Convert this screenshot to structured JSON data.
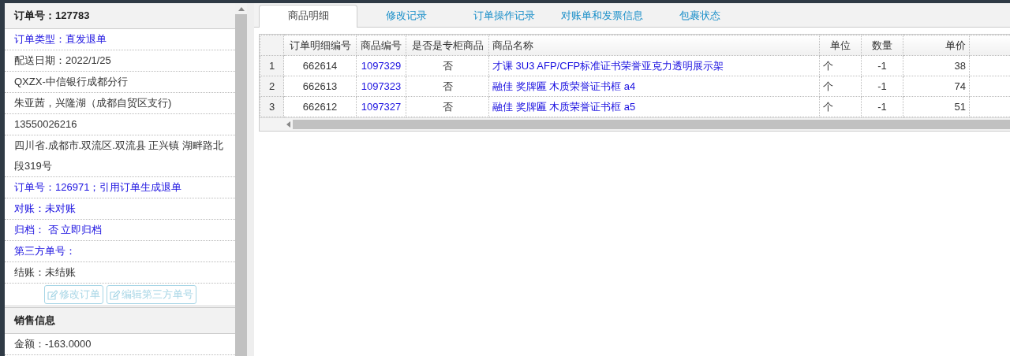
{
  "order_panel": {
    "title": "订单号：127783",
    "rows": [
      {
        "kind": "link",
        "text": "订单类型：直发退单"
      },
      {
        "kind": "plain",
        "text": "配送日期：2022/1/25"
      },
      {
        "kind": "plain",
        "text": "QXZX-中信银行成都分行"
      },
      {
        "kind": "plain",
        "text": "朱亚茜，兴隆湖（成都自贸区支行)"
      },
      {
        "kind": "plain",
        "text": "13550026216"
      },
      {
        "kind": "plain",
        "text": "四川省.成都市.双流区.双流县 正兴镇 湖畔路北段319号"
      },
      {
        "kind": "link",
        "text": "订单号：126971；引用订单生成退单"
      },
      {
        "kind": "link",
        "text": "对账：未对账"
      },
      {
        "kind": "link",
        "text": "归档： 否 立即归档"
      },
      {
        "kind": "link",
        "text": "第三方单号："
      },
      {
        "kind": "plain",
        "text": "结账：未结账"
      }
    ],
    "buttons": [
      {
        "label": "修改订单",
        "disabled": true
      },
      {
        "label": "编辑第三方单号",
        "disabled": true
      }
    ],
    "sales_title": "销售信息",
    "sales_rows": [
      "金额：-163.0000"
    ]
  },
  "tabs": [
    {
      "label": "商品明细",
      "selected": true
    },
    {
      "label": "修改记录",
      "selected": false
    },
    {
      "label": "订单操作记录",
      "selected": false
    },
    {
      "label": "对账单和发票信息",
      "selected": false
    },
    {
      "label": "包裹状态",
      "selected": false
    }
  ],
  "table": {
    "columns": [
      "订单明细编号",
      "商品编号",
      "是否是专柜商品",
      "商品名称",
      "单位",
      "数量",
      "单价"
    ],
    "rows": [
      {
        "index": "1",
        "cells": [
          "662614",
          "1097329",
          "否",
          "才课 3U3 AFP/CFP标准证书荣誉亚克力透明展示架",
          "个",
          "-1",
          "38"
        ]
      },
      {
        "index": "2",
        "cells": [
          "662613",
          "1097323",
          "否",
          "融佳 奖牌匾 木质荣誉证书框 a4",
          "个",
          "-1",
          "74"
        ]
      },
      {
        "index": "3",
        "cells": [
          "662612",
          "1097327",
          "否",
          "融佳 奖牌匾 木质荣誉证书框 a5",
          "个",
          "-1",
          "51"
        ]
      }
    ]
  }
}
